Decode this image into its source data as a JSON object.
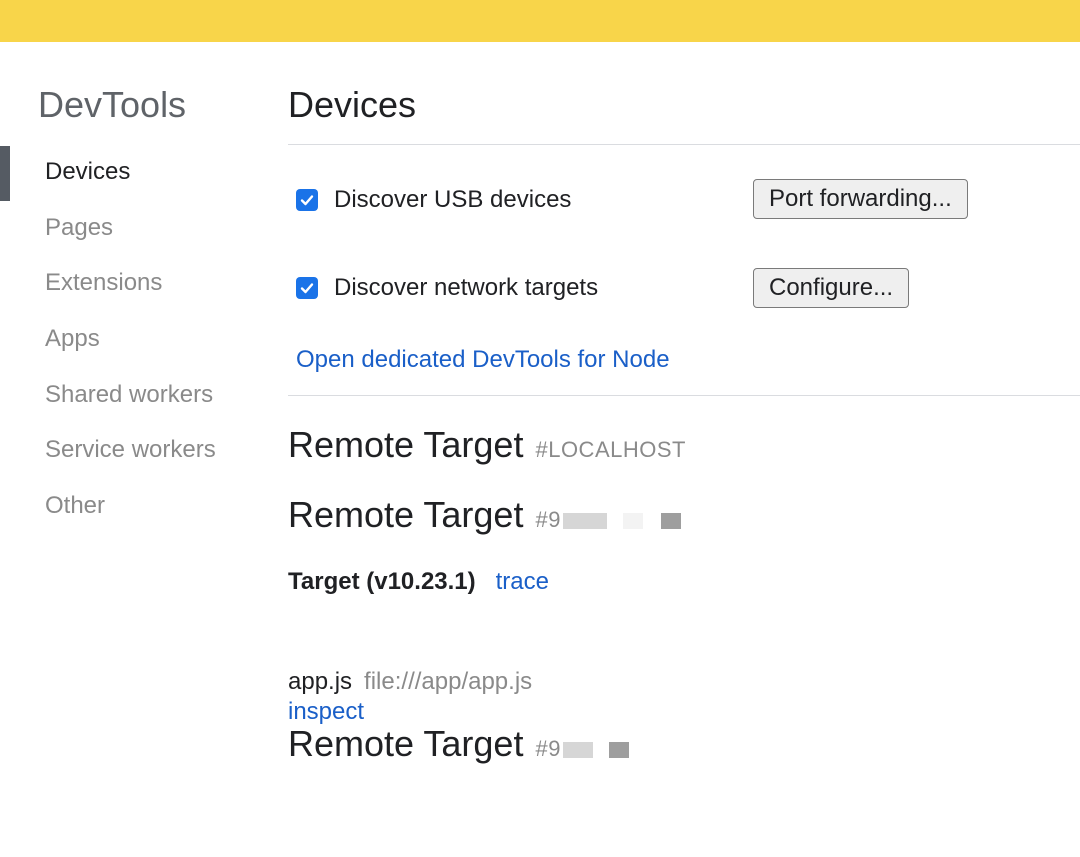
{
  "sidebar": {
    "title": "DevTools",
    "items": [
      {
        "label": "Devices",
        "active": true
      },
      {
        "label": "Pages"
      },
      {
        "label": "Extensions"
      },
      {
        "label": "Apps"
      },
      {
        "label": "Shared workers"
      },
      {
        "label": "Service workers"
      },
      {
        "label": "Other"
      }
    ]
  },
  "main": {
    "title": "Devices",
    "options": {
      "usb": {
        "label": "Discover USB devices",
        "checked": true,
        "button": "Port forwarding..."
      },
      "network": {
        "label": "Discover network targets",
        "checked": true,
        "button": "Configure..."
      }
    },
    "node_link": "Open dedicated DevTools for Node",
    "remote_targets": [
      {
        "label": "Remote Target",
        "id": "#LOCALHOST"
      },
      {
        "label": "Remote Target",
        "id": "#9"
      },
      {
        "label": "Remote Target",
        "id": "#9"
      }
    ],
    "target": {
      "name": "Target (v10.23.1)",
      "trace": "trace",
      "app_name": "app.js",
      "app_url": "file:///app/app.js",
      "inspect": "inspect"
    }
  },
  "colors": {
    "banner": "#f8d54a",
    "link": "#1a5fc8",
    "checkbox": "#1a73e8",
    "active_marker": "#555b63"
  },
  "icons": {
    "checkbox": "checkmark-icon"
  }
}
